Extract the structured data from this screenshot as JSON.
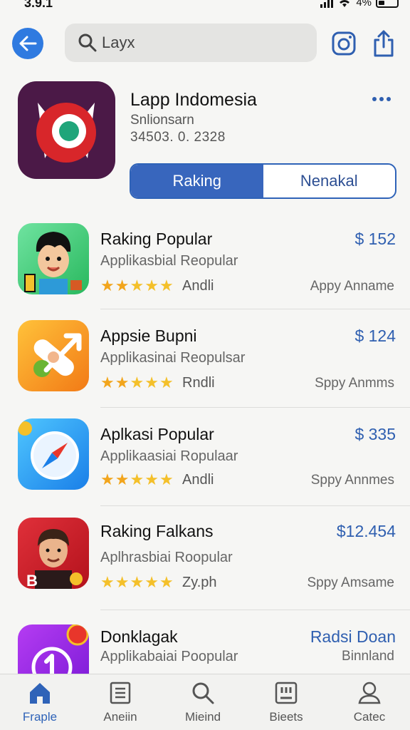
{
  "status": {
    "time": "3.9.1",
    "battery": "4%"
  },
  "search": {
    "text": "Layx"
  },
  "hero": {
    "title": "Lapp Indomesia",
    "subtitle": "Snlionsarn",
    "version": "34503. 0. 2328",
    "tabs": [
      "Raking",
      "Nenakal"
    ],
    "active_tab": "Raking"
  },
  "apps": [
    {
      "name": "Raking Popular",
      "desc": "Applikasbial Reopular",
      "tag": "Andli",
      "price": "$ 152",
      "dev": "Appy Anname",
      "stars": 5,
      "icon": "cartoon-boy-icon"
    },
    {
      "name": "Appsie Bupni",
      "desc": "Applikasinai Reopulsar",
      "tag": "Rndli",
      "price": "$ 124",
      "dev": "Sppy Anmms",
      "stars": 5,
      "icon": "bandage-arrow-icon"
    },
    {
      "name": "Aplkasi Popular",
      "desc": "Applikaasiai Ropulaar",
      "tag": "Andli",
      "price": "$ 335",
      "dev": "Sppy Annmes",
      "stars": 5,
      "icon": "compass-icon"
    },
    {
      "name": "Raking Falkans",
      "desc": "Aplhrasbiai Roopular",
      "tag": "Zy.ph",
      "price": "$12.454",
      "dev": "Sppy Amsame",
      "stars": 5,
      "icon": "man-portrait-icon"
    },
    {
      "name": "Donklagak",
      "desc": "Applikabaiai Poopular",
      "tag": "",
      "price": "Radsi Doan",
      "dev": "Binnland",
      "stars": 0,
      "icon": "purple-badge-icon"
    }
  ],
  "tabbar": [
    {
      "label": "Fraple",
      "icon": "home-icon",
      "active": true
    },
    {
      "label": "Aneiin",
      "icon": "list-icon",
      "active": false
    },
    {
      "label": "Mieind",
      "icon": "search-icon",
      "active": false
    },
    {
      "label": "Bieets",
      "icon": "grid-icon",
      "active": false
    },
    {
      "label": "Catec",
      "icon": "person-icon",
      "active": false
    }
  ],
  "colors": {
    "accent": "#2f63b8",
    "star": "#f2a51c",
    "price": "#2f5fb0"
  }
}
